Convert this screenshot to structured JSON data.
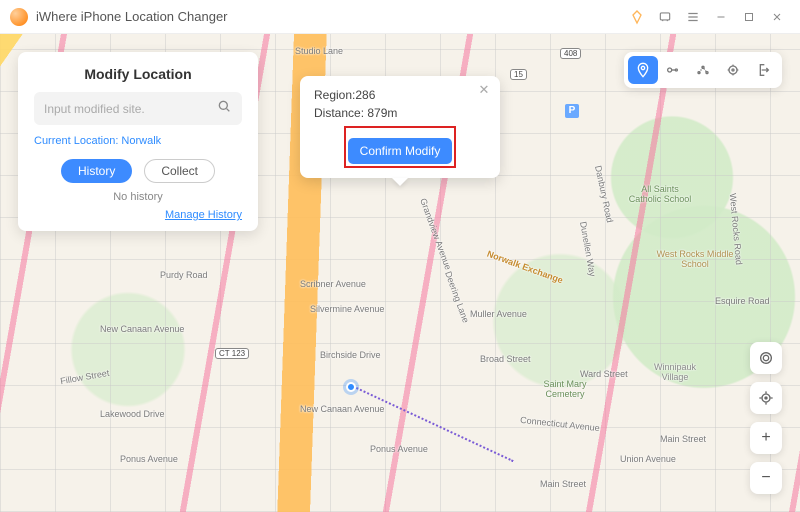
{
  "titlebar": {
    "app_name": "iWhere iPhone Location Changer"
  },
  "panel": {
    "heading": "Modify Location",
    "search_placeholder": "Input modified site.",
    "current_location_label": "Current Location: Norwalk",
    "tab_history": "History",
    "tab_collect": "Collect",
    "no_history": "No history",
    "manage_history": "Manage History"
  },
  "popup": {
    "region_label": "Region:",
    "region_value": "286",
    "distance_label": "Distance:",
    "distance_value": "879m",
    "confirm_label": "Confirm Modify"
  },
  "map": {
    "parking_label": "P",
    "roads": {
      "ponus": "Ponus Avenue",
      "new_canaan": "New Canaan Avenue",
      "connecticut": "Connecticut Avenue",
      "scribner": "Scribner Avenue",
      "lakewood": "Lakewood Drive",
      "fillow": "Fillow Street",
      "purdy": "Purdy Road",
      "studio": "Studio Lane",
      "birchside": "Birchside Drive",
      "deering": "Deering Lane",
      "silvermine": "Silvermine Avenue",
      "muller": "Muller Avenue",
      "broad": "Broad Street",
      "ward": "Ward Street",
      "main": "Main Street",
      "union": "Union Avenue",
      "dunellen": "Dunellen Way",
      "danbury": "Danbury Road",
      "esquire": "Esquire Road",
      "grandview": "Grandview Avenue",
      "west_rocks": "West Rocks Road",
      "norwalk_exch": "Norwalk Exchange"
    },
    "pois": {
      "all_saints": "All Saints Catholic School",
      "west_rocks_ms": "West Rocks Middle School",
      "winnipauk": "Winnipauk Village",
      "saint_mary": "Saint Mary Cemetery"
    },
    "shields": {
      "ct123": "CT 123",
      "r15": "15",
      "r408": "408"
    }
  },
  "controls": {
    "zoom_in": "+",
    "zoom_out": "−"
  }
}
